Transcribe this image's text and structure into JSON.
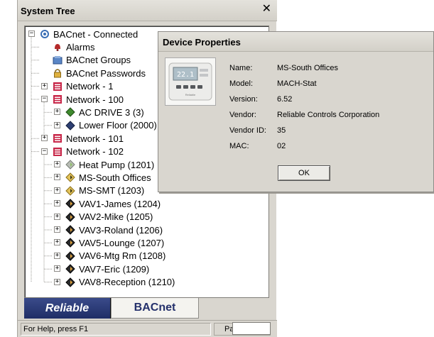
{
  "panel": {
    "title": "System Tree",
    "close_glyph": "✕"
  },
  "tree": [
    {
      "label": "BACnet - Connected",
      "icon": "network-connected-icon",
      "expander": "minus"
    },
    {
      "label": "Alarms",
      "icon": "alarm-bell-icon",
      "expander": ""
    },
    {
      "label": "BACnet Groups",
      "icon": "groups-icon",
      "expander": ""
    },
    {
      "label": "BACnet Passwords",
      "icon": "padlock-icon",
      "expander": ""
    },
    {
      "label": "Network - 1",
      "icon": "network-icon",
      "expander": "plus"
    },
    {
      "label": "Network - 100",
      "icon": "network-icon",
      "expander": "minus"
    },
    {
      "label": "AC DRIVE 3 (3)",
      "icon": "device-green-icon",
      "expander": "plus"
    },
    {
      "label": "Lower Floor (2000)",
      "icon": "device-blue-icon",
      "expander": "plus"
    },
    {
      "label": "Network - 101",
      "icon": "network-icon",
      "expander": "plus"
    },
    {
      "label": "Network - 102",
      "icon": "network-icon",
      "expander": "minus"
    },
    {
      "label": "Heat Pump (1201)",
      "icon": "device-gray-icon",
      "expander": "plus"
    },
    {
      "label": "MS-South Offices",
      "icon": "device-yellow-icon",
      "expander": "plus"
    },
    {
      "label": "MS-SMT (1203)",
      "icon": "device-yellow-icon",
      "expander": "plus"
    },
    {
      "label": "VAV1-James (1204)",
      "icon": "device-dark-icon",
      "expander": "plus"
    },
    {
      "label": "VAV2-Mike (1205)",
      "icon": "device-dark-icon",
      "expander": "plus"
    },
    {
      "label": "VAV3-Roland (1206)",
      "icon": "device-dark-icon",
      "expander": "plus"
    },
    {
      "label": "VAV5-Lounge (1207)",
      "icon": "device-dark-icon",
      "expander": "plus"
    },
    {
      "label": "VAV6-Mtg Rm (1208)",
      "icon": "device-dark-icon",
      "expander": "plus"
    },
    {
      "label": "VAV7-Eric (1209)",
      "icon": "device-dark-icon",
      "expander": "plus"
    },
    {
      "label": "VAV8-Reception (1210)",
      "icon": "device-dark-icon",
      "expander": "plus"
    }
  ],
  "brand": {
    "reliable_label": "Reliable",
    "bacnet_label": "BACnet"
  },
  "status": {
    "help_text": "For Help, press F1",
    "panel_label": "Panel:"
  },
  "dialog": {
    "title": "Device Properties",
    "device_display": "22.1",
    "device_caption": "Reliable",
    "fields": [
      {
        "label": "Name:",
        "value": "MS-South Offices"
      },
      {
        "label": "Model:",
        "value": "MACH-Stat"
      },
      {
        "label": "Version:",
        "value": "6.52"
      },
      {
        "label": "Vendor:",
        "value": "Reliable Controls Corporation"
      },
      {
        "label": "Vendor ID:",
        "value": "35"
      },
      {
        "label": "MAC:",
        "value": "02"
      }
    ],
    "ok_label": "OK"
  },
  "colors": {
    "panel_bg": "#d9d6cf",
    "brand_navy": "#24306b",
    "network_icon": "#c8284a"
  }
}
